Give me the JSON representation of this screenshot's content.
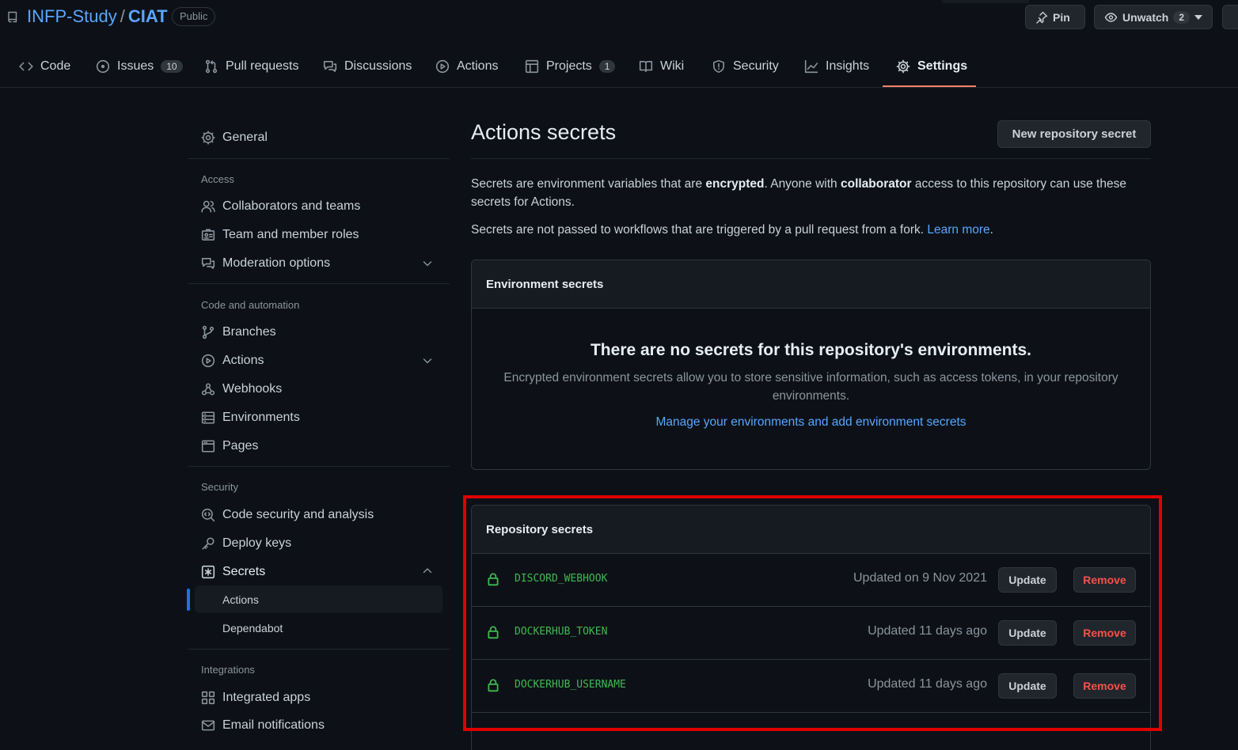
{
  "repo": {
    "owner": "INFP-Study",
    "separator": "/",
    "name": "CIAT",
    "visibility": "Public",
    "pin_label": "Pin",
    "watch_label": "Unwatch",
    "watch_count": "2"
  },
  "tabs": [
    {
      "label": "Code",
      "icon": "code-icon"
    },
    {
      "label": "Issues",
      "icon": "issue-opened-icon",
      "count": "10"
    },
    {
      "label": "Pull requests",
      "icon": "git-pull-request-icon"
    },
    {
      "label": "Discussions",
      "icon": "comment-discussion-icon"
    },
    {
      "label": "Actions",
      "icon": "play-icon"
    },
    {
      "label": "Projects",
      "icon": "table-icon",
      "count": "1"
    },
    {
      "label": "Wiki",
      "icon": "book-icon"
    },
    {
      "label": "Security",
      "icon": "shield-icon"
    },
    {
      "label": "Insights",
      "icon": "graph-icon"
    },
    {
      "label": "Settings",
      "icon": "gear-icon",
      "active": true
    }
  ],
  "sidebar": {
    "general": "General",
    "groups": {
      "access": "Access",
      "code_automation": "Code and automation",
      "security": "Security",
      "integrations": "Integrations"
    },
    "items": {
      "collaborators": "Collaborators and teams",
      "team_roles": "Team and member roles",
      "moderation": "Moderation options",
      "branches": "Branches",
      "actions": "Actions",
      "webhooks": "Webhooks",
      "environments": "Environments",
      "pages": "Pages",
      "code_security": "Code security and analysis",
      "deploy_keys": "Deploy keys",
      "secrets": "Secrets",
      "secrets_actions": "Actions",
      "secrets_dependabot": "Dependabot",
      "integrated_apps": "Integrated apps",
      "email_notifications": "Email notifications"
    }
  },
  "main": {
    "title": "Actions secrets",
    "new_secret_button": "New repository secret",
    "desc1_a": "Secrets are environment variables that are ",
    "desc1_b": "encrypted",
    "desc1_c": ". Anyone with ",
    "desc1_d": "collaborator",
    "desc1_e": " access to this repository can use these secrets for Actions.",
    "desc2_a": "Secrets are not passed to workflows that are triggered by a pull request from a fork. ",
    "desc2_link": "Learn more",
    "desc2_end": ".",
    "env": {
      "header": "Environment secrets",
      "blank_title": "There are no secrets for this repository's environments.",
      "blank_text": "Encrypted environment secrets allow you to store sensitive information, such as access tokens, in your repository environments.",
      "blank_link": "Manage your environments and add environment secrets"
    },
    "repo_secrets": {
      "header": "Repository secrets",
      "update_label": "Update",
      "remove_label": "Remove",
      "rows": [
        {
          "name": "DISCORD_WEBHOOK",
          "updated": "Updated on 9 Nov 2021"
        },
        {
          "name": "DOCKERHUB_TOKEN",
          "updated": "Updated 11 days ago"
        },
        {
          "name": "DOCKERHUB_USERNAME",
          "updated": "Updated 11 days ago"
        }
      ]
    }
  },
  "colors": {
    "background": "#0d1117",
    "link": "#58a6ff",
    "secret_name": "#3fb950",
    "remove_text": "#f85149",
    "active_tab_underline": "#f78166",
    "highlight_box": "#e00000"
  }
}
